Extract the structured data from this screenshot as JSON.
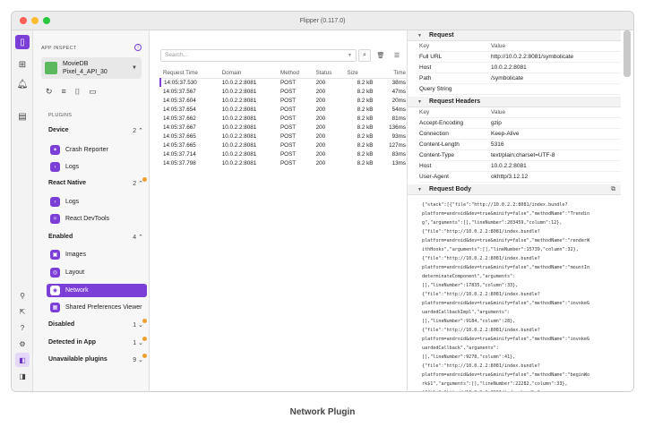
{
  "window": {
    "title": "Flipper (0.117.0)"
  },
  "sidebar": {
    "app_inspect": "APP INSPECT",
    "device": {
      "name": "MovieDB",
      "model": "Pixel_4_API_30"
    },
    "plugins_header": "PLUGINS",
    "groups": {
      "device": {
        "label": "Device",
        "count": "2"
      },
      "react_native": {
        "label": "React Native",
        "count": "2"
      },
      "enabled": {
        "label": "Enabled",
        "count": "4"
      },
      "disabled": {
        "label": "Disabled",
        "count": "1"
      },
      "detected": {
        "label": "Detected in App",
        "count": "1"
      },
      "unavailable": {
        "label": "Unavailable plugins",
        "count": "9"
      }
    },
    "items": {
      "crash_reporter": "Crash Reporter",
      "device_logs": "Logs",
      "rn_logs": "Logs",
      "react_devtools": "React DevTools",
      "images": "Images",
      "layout": "Layout",
      "network": "Network",
      "shared_prefs": "Shared Preferences Viewer"
    }
  },
  "main": {
    "search_placeholder": "Search...",
    "columns": [
      "Request Time",
      "Domain",
      "Method",
      "Status",
      "Size",
      "Time"
    ],
    "rows": [
      [
        "14:05:37.530",
        "10.0.2.2:8081",
        "POST",
        "200",
        "8.2 kB",
        "38ms"
      ],
      [
        "14:05:37.567",
        "10.0.2.2:8081",
        "POST",
        "200",
        "8.2 kB",
        "47ms"
      ],
      [
        "14:05:37.604",
        "10.0.2.2:8081",
        "POST",
        "200",
        "8.2 kB",
        "20ms"
      ],
      [
        "14:05:37.654",
        "10.0.2.2:8081",
        "POST",
        "200",
        "8.2 kB",
        "54ms"
      ],
      [
        "14:05:37.662",
        "10.0.2.2:8081",
        "POST",
        "200",
        "8.2 kB",
        "81ms"
      ],
      [
        "14:05:37.667",
        "10.0.2.2:8081",
        "POST",
        "200",
        "8.2 kB",
        "136ms"
      ],
      [
        "14:05:37.665",
        "10.0.2.2:8081",
        "POST",
        "200",
        "8.2 kB",
        "93ms"
      ],
      [
        "14:05:37.665",
        "10.0.2.2:8081",
        "POST",
        "200",
        "8.2 kB",
        "127ms"
      ],
      [
        "14:05:37.714",
        "10.0.2.2:8081",
        "POST",
        "200",
        "8.2 kB",
        "83ms"
      ],
      [
        "14:05:37.798",
        "10.0.2.2:8081",
        "POST",
        "200",
        "8.2 kB",
        "13ms"
      ]
    ]
  },
  "detail": {
    "request_title": "Request",
    "key_label": "Key",
    "value_label": "Value",
    "request": [
      [
        "Full URL",
        "http://10.0.2.2:8081/symbolicate"
      ],
      [
        "Host",
        "10.0.2.2:8081"
      ],
      [
        "Path",
        "/symbolicate"
      ],
      [
        "Query String",
        ""
      ]
    ],
    "headers_title": "Request Headers",
    "headers": [
      [
        "Accept-Encoding",
        "gzip"
      ],
      [
        "Connection",
        "Keep-Alive"
      ],
      [
        "Content-Length",
        "5316"
      ],
      [
        "Content-Type",
        "text/plain;charset=UTF-8"
      ],
      [
        "Host",
        "10.0.2.2:8081"
      ],
      [
        "User-Agent",
        "okhttp/3.12.12"
      ]
    ],
    "body_title": "Request Body",
    "body_text": "{\"stack\":[{\"file\":\"http://10.0.2.2:8081/index.bundle?\nplatform=android&dev=true&minify=false\",\"methodName\":\"Trendin\ng\",\"arguments\":[],\"lineNumber\":203459,\"column\":12},\n{\"file\":\"http://10.0.2.2:8081/index.bundle?\nplatform=android&dev=true&minify=false\",\"methodName\":\"renderW\nithHooks\",\"arguments\":[],\"lineNumber\":15739,\"column\":32},\n{\"file\":\"http://10.0.2.2:8081/index.bundle?\nplatform=android&dev=true&minify=false\",\"methodName\":\"mountIn\ndeterminateComponent\",\"arguments\":\n[],\"lineNumber\":17835,\"column\":33},\n{\"file\":\"http://10.0.2.2:8081/index.bundle?\nplatform=android&dev=true&minify=false\",\"methodName\":\"invokeG\nuardedCallbackImpl\",\"arguments\":\n[],\"lineNumber\":9184,\"column\":28},\n{\"file\":\"http://10.0.2.2:8081/index.bundle?\nplatform=android&dev=true&minify=false\",\"methodName\":\"invokeG\nuardedCallback\",\"arguments\":\n[],\"lineNumber\":9278,\"column\":41},\n{\"file\":\"http://10.0.2.2:8081/index.bundle?\nplatform=android&dev=true&minify=false\",\"methodName\":\"beginWo\nrk$1\",\"arguments\":[],\"lineNumber\":22282,\"column\":33},\n{\"file\":\"http://10.0.2.2:8081/index.bundle?"
  },
  "caption": "Network Plugin",
  "colors": {
    "accent": "#7b3ed6",
    "badge": "#f0a030"
  },
  "icons": [
    "purple-app-icon",
    "grid-icon",
    "bell-icon",
    "document-icon",
    "info-icon",
    "refresh-icon",
    "menu-icon",
    "camera-icon",
    "video-icon",
    "search-icon",
    "trash-icon",
    "list-icon",
    "copy-icon"
  ]
}
